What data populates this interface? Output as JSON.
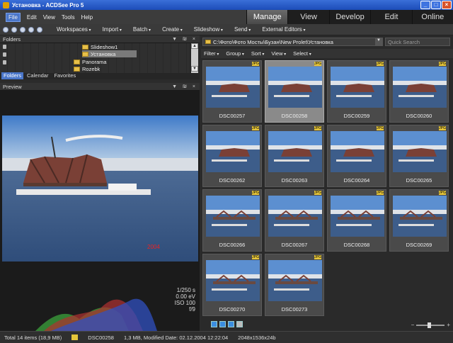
{
  "window": {
    "title": "Установка - ACDSee Pro 5",
    "minimize": "_",
    "maximize": "□",
    "close": "×"
  },
  "menu": [
    "File",
    "Edit",
    "View",
    "Tools",
    "Help"
  ],
  "modes": [
    "Manage",
    "View",
    "Develop",
    "Edit",
    "Online"
  ],
  "toolbar": [
    "Workspaces",
    "Import",
    "Batch",
    "Create",
    "Slideshow",
    "Send",
    "External Editors"
  ],
  "folders": {
    "title": "Folders",
    "controls": "▼ ₪ ×",
    "items": [
      "Slideshow1",
      "Установка",
      "Panorama",
      "Rozebk"
    ],
    "tabs": [
      "Folders",
      "Calendar",
      "Favorites"
    ]
  },
  "preview": {
    "title": "Preview",
    "controls": "▼ ₪ ×",
    "exif": [
      "1/250 s",
      "0.00 eV",
      "ISO 100",
      "f/9"
    ]
  },
  "browser": {
    "path": "C:\\Фото\\Фото Мосты\\Бузан\\New Prolet\\Установка",
    "search_placeholder": "Quick Search",
    "filters": [
      "Filter",
      "Group",
      "Sort",
      "View",
      "Select"
    ],
    "thumbnails": [
      "DSC00257",
      "DSC00258",
      "DSC00259",
      "DSC00260",
      "DSC00262",
      "DSC00263",
      "DSC00264",
      "DSC00265",
      "DSC00266",
      "DSC00267",
      "DSC00268",
      "DSC00269",
      "DSC00270",
      "DSC00273"
    ],
    "selected_index": 1,
    "badge": "JPG",
    "zoom_minus": "−",
    "zoom_plus": "+"
  },
  "status": {
    "total": "Total 14 items  (18,9 MB)",
    "file": "DSC00258",
    "info": "1,3 MB, Modified Date: 02.12.2004 12:22:04",
    "dims": "2048x1536x24b"
  }
}
